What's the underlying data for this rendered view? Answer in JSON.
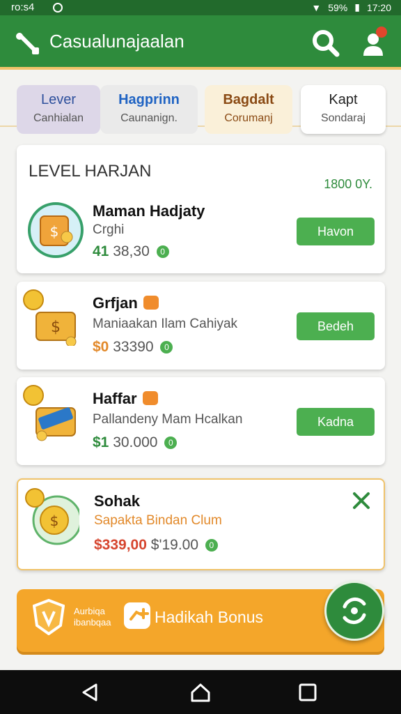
{
  "status": {
    "time_left": "ro:s4",
    "time_right": "17:20",
    "battery": "59%"
  },
  "header": {
    "title": "Casualunajaalan"
  },
  "tabs": [
    {
      "line1": "Lever",
      "line2": "Canhialan"
    },
    {
      "line1": "Hagprinn",
      "line2": "Caunanign."
    },
    {
      "line1": "Bagdalt",
      "line2": "Corumanj"
    },
    {
      "line1": "Kapt",
      "line2": "Sondaraj"
    }
  ],
  "level_card": {
    "heading": "LEVEL HARJAN",
    "percent": "1800 0Y.",
    "item": {
      "name": "Maman Hadjaty",
      "sub": "Crghi",
      "price_main": "41",
      "price_rest": "38,30",
      "gem": "0",
      "button": "Havon"
    }
  },
  "items": [
    {
      "name": "Grfjan",
      "sub": "Maniaakan Ilam Cahiyak",
      "price_main": "$0",
      "price_rest": "33390",
      "gem": "0",
      "button": "Bedeh"
    },
    {
      "name": "Haffar",
      "sub": "Pallandeny Mam Hcalkan",
      "price_main": "$1",
      "price_rest": "30.000",
      "gem": "0",
      "button": "Kadnа"
    }
  ],
  "sale": {
    "name": "Sohak",
    "sub": "Sapakta Bindan Clum",
    "price_old": "$339,00",
    "price_new": "$'19.00",
    "gem": "0"
  },
  "bonus": {
    "small_line1": "Aurbiqa",
    "small_line2": "ibanbqaa",
    "label": "Hadikah Bonus"
  },
  "colors": {
    "primary": "#2e8b3c",
    "accent": "#f4a62a",
    "button": "#4caf50"
  }
}
